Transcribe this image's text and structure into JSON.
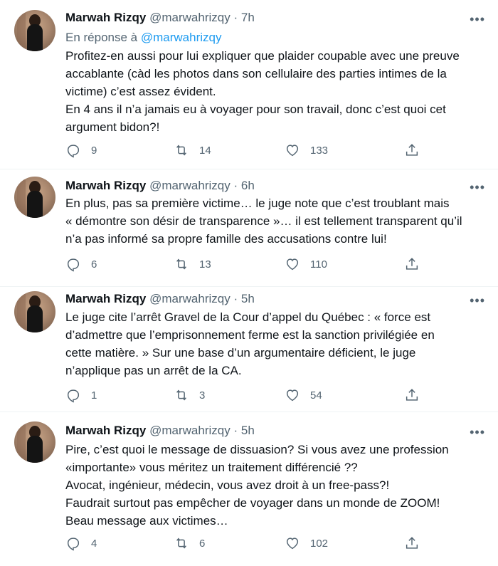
{
  "tweets": [
    {
      "name": "Marwah Rizqy",
      "handle": "@marwahrizqy",
      "separator": "·",
      "time": "7h",
      "reply_prefix": "En réponse à",
      "reply_handle": "@marwahrizqy",
      "lines": [
        "Profitez-en aussi pour lui expliquer que plaider coupable avec une preuve",
        "accablante (càd les photos dans son cellulaire des parties intimes de la",
        "victime) c’est assez évident.",
        "En 4 ans il n’a jamais eu à voyager pour son travail, donc c’est quoi cet",
        "argument bidon?!"
      ],
      "replies": "9",
      "retweets": "14",
      "likes": "133"
    },
    {
      "name": "Marwah Rizqy",
      "handle": "@marwahrizqy",
      "separator": "·",
      "time": "6h",
      "lines": [
        "En plus, pas sa première victime… le juge note que c’est troublant mais",
        "« démontre son désir de transparence »… il est tellement transparent qu’il",
        "n’a pas informé sa propre famille des accusations contre lui!"
      ],
      "replies": "6",
      "retweets": "13",
      "likes": "110"
    },
    {
      "name": "Marwah Rizqy",
      "handle": "@marwahrizqy",
      "separator": "·",
      "time": "5h",
      "lines": [
        "Le juge cite l’arrêt Gravel de la Cour d’appel du Québec : « force est",
        "d’admettre que l’emprisonnement ferme est la sanction privilégiée en",
        "cette matière. » Sur une base d’un argumentaire déficient, le juge",
        "n’applique pas un arrêt de la CA."
      ],
      "replies": "1",
      "retweets": "3",
      "likes": "54"
    },
    {
      "name": "Marwah Rizqy",
      "handle": "@marwahrizqy",
      "separator": "·",
      "time": "5h",
      "lines": [
        "Pire, c’est quoi le message de dissuasion? Si vous avez une profession",
        "«importante» vous méritez un traitement différencié ??",
        "Avocat, ingénieur, médecin, vous avez droit à un free-pass?!",
        "Faudrait surtout pas empêcher de voyager dans un monde de ZOOM!",
        "Beau message aux victimes…"
      ],
      "replies": "4",
      "retweets": "6",
      "likes": "102"
    }
  ],
  "icons": {
    "more": "more-icon",
    "reply": "reply-icon",
    "retweet": "retweet-icon",
    "like": "heart-icon",
    "share": "share-icon"
  },
  "colors": {
    "text": "#0f1419",
    "secondary": "#536471",
    "link": "#1d9bf0",
    "divider": "#eff3f4"
  }
}
